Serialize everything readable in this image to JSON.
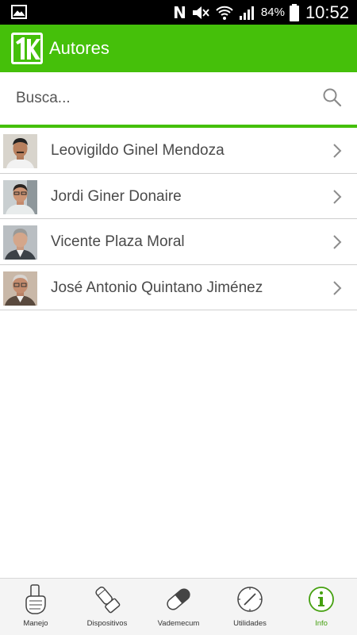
{
  "status_bar": {
    "battery": "84%",
    "time": "10:52",
    "n_glyph": "N"
  },
  "app_bar": {
    "title": "Autores",
    "color": "#45c00a"
  },
  "search": {
    "placeholder": "Busca..."
  },
  "authors": [
    {
      "name": "Leovigildo Ginel Mendoza"
    },
    {
      "name": "Jordi Giner Donaire"
    },
    {
      "name": "Vicente Plaza Moral"
    },
    {
      "name": "José Antonio Quintano Jiménez"
    }
  ],
  "bottom_nav": {
    "items": [
      {
        "label": "Manejo",
        "icon": "inhaler-hand-icon"
      },
      {
        "label": "Dispositivos",
        "icon": "inhaler-device-icon"
      },
      {
        "label": "Vademecum",
        "icon": "pill-icon"
      },
      {
        "label": "Utilidades",
        "icon": "compass-icon"
      },
      {
        "label": "Info",
        "icon": "info-icon",
        "active": true
      }
    ]
  }
}
